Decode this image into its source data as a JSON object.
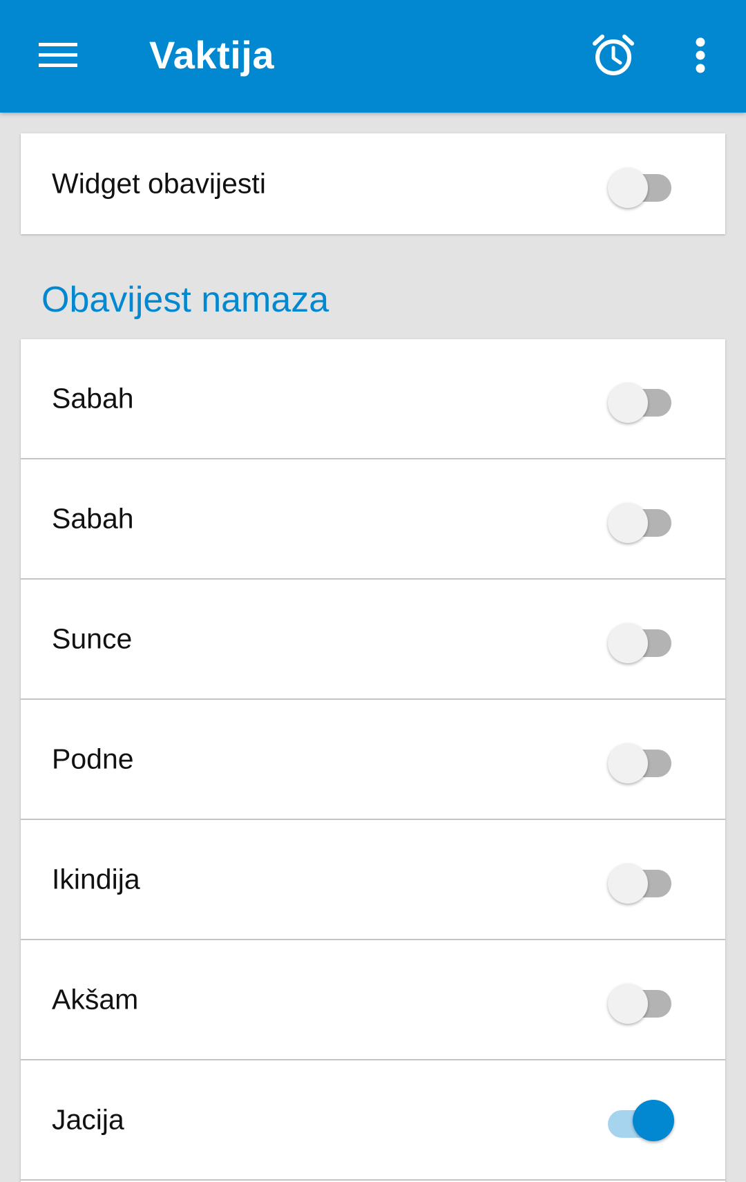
{
  "app_bar": {
    "title": "Vaktija",
    "menu_icon": "hamburger-menu-icon",
    "alarm_icon": "alarm-clock-icon",
    "more_icon": "more-vert-icon",
    "color": "#0288d1"
  },
  "widget_card": {
    "label": "Widget obavijesti",
    "enabled": false
  },
  "prayer_section": {
    "header": "Obavijest namaza",
    "items": [
      {
        "label": "Sabah",
        "enabled": false
      },
      {
        "label": "Sabah",
        "enabled": false
      },
      {
        "label": "Sunce",
        "enabled": false
      },
      {
        "label": "Podne",
        "enabled": false
      },
      {
        "label": "Ikindija",
        "enabled": false
      },
      {
        "label": "Akšam",
        "enabled": false
      },
      {
        "label": "Jacija",
        "enabled": true
      }
    ]
  },
  "colors": {
    "accent": "#0288d1",
    "switch_on_track": "#a6d4ef",
    "switch_off_track": "#b3b3b3",
    "switch_off_thumb": "#f1f1f1",
    "background": "#e3e3e3"
  }
}
